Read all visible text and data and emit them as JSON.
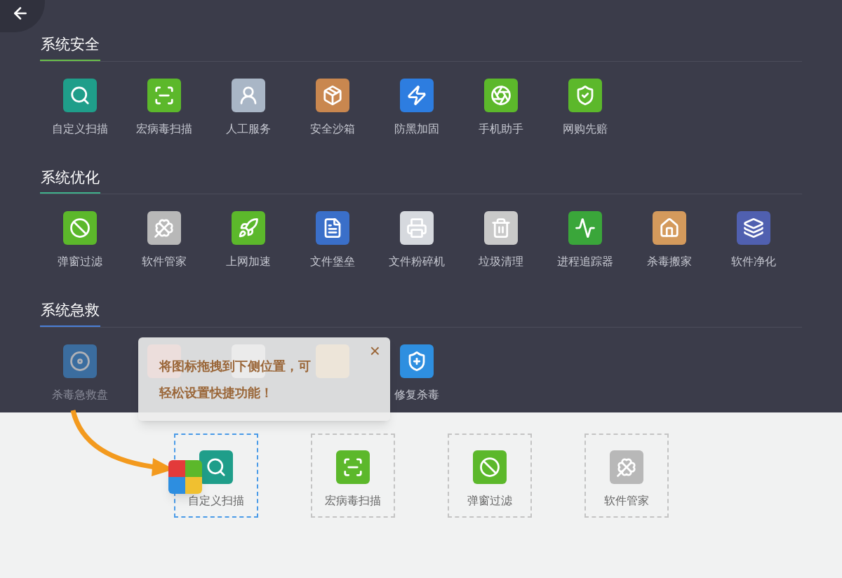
{
  "sections": [
    {
      "title": "系统安全",
      "color": "#6abf4b",
      "items": [
        {
          "label": "自定义扫描",
          "dimmed": false
        },
        {
          "label": "宏病毒扫描",
          "dimmed": false
        },
        {
          "label": "人工服务",
          "dimmed": false
        },
        {
          "label": "安全沙箱",
          "dimmed": false
        },
        {
          "label": "防黑加固",
          "dimmed": false
        },
        {
          "label": "手机助手",
          "dimmed": false
        },
        {
          "label": "网购先赔",
          "dimmed": false
        }
      ]
    },
    {
      "title": "系统优化",
      "color": "#3fb08a",
      "items": [
        {
          "label": "弹窗过滤",
          "dimmed": false
        },
        {
          "label": "软件管家",
          "dimmed": false
        },
        {
          "label": "上网加速",
          "dimmed": false
        },
        {
          "label": "文件堡垒",
          "dimmed": false
        },
        {
          "label": "文件粉碎机",
          "dimmed": false
        },
        {
          "label": "垃圾清理",
          "dimmed": false
        },
        {
          "label": "进程追踪器",
          "dimmed": false
        },
        {
          "label": "杀毒搬家",
          "dimmed": false
        },
        {
          "label": "软件净化",
          "dimmed": false
        }
      ]
    },
    {
      "title": "系统急救",
      "color": "#4a7fd6",
      "items": [
        {
          "label": "杀毒急救盘",
          "dimmed": true
        },
        {
          "kind": "covered"
        },
        {
          "kind": "covered"
        },
        {
          "kind": "covered"
        },
        {
          "label": "修复杀毒",
          "dimmed": false
        }
      ]
    }
  ],
  "tooltip": {
    "text": "将图标拖拽到下侧位置，可轻松设置快捷功能！",
    "close": "×"
  },
  "shortcuts": [
    {
      "label": "自定义扫描",
      "selected": true
    },
    {
      "label": "宏病毒扫描",
      "selected": false
    },
    {
      "label": "弹窗过滤",
      "selected": false
    },
    {
      "label": "软件管家",
      "selected": false
    }
  ]
}
